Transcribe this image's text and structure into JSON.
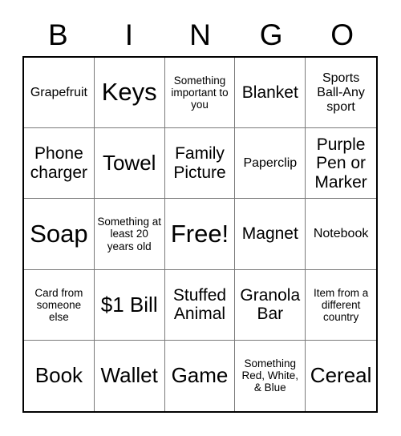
{
  "card": {
    "header_letters": [
      "B",
      "I",
      "N",
      "G",
      "O"
    ],
    "rows": [
      [
        {
          "text": "Grapefruit",
          "size": "t-sm"
        },
        {
          "text": "Keys",
          "size": "t-xl"
        },
        {
          "text": "Something important to you",
          "size": "t-xs"
        },
        {
          "text": "Blanket",
          "size": "t-md"
        },
        {
          "text": "Sports Ball-Any sport",
          "size": "t-sm"
        }
      ],
      [
        {
          "text": "Phone charger",
          "size": "t-md"
        },
        {
          "text": "Towel",
          "size": "t-lg"
        },
        {
          "text": "Family Picture",
          "size": "t-md"
        },
        {
          "text": "Paperclip",
          "size": "t-sm"
        },
        {
          "text": "Purple Pen or Marker",
          "size": "t-md"
        }
      ],
      [
        {
          "text": "Soap",
          "size": "t-xl"
        },
        {
          "text": "Something at least 20 years old",
          "size": "t-xs"
        },
        {
          "text": "Free!",
          "size": "t-xl"
        },
        {
          "text": "Magnet",
          "size": "t-md"
        },
        {
          "text": "Notebook",
          "size": "t-sm"
        }
      ],
      [
        {
          "text": "Card from someone else",
          "size": "t-xs"
        },
        {
          "text": "$1 Bill",
          "size": "t-lg"
        },
        {
          "text": "Stuffed Animal",
          "size": "t-md"
        },
        {
          "text": "Granola Bar",
          "size": "t-md"
        },
        {
          "text": "Item from a different country",
          "size": "t-xs"
        }
      ],
      [
        {
          "text": "Book",
          "size": "t-lg"
        },
        {
          "text": "Wallet",
          "size": "t-lg"
        },
        {
          "text": "Game",
          "size": "t-lg"
        },
        {
          "text": "Something Red, White, & Blue",
          "size": "t-xs"
        },
        {
          "text": "Cereal",
          "size": "t-lg"
        }
      ]
    ],
    "colors": {
      "outer_border": "#000000",
      "inner_border": "#7a7a7a",
      "cell_background": "#ffffff",
      "text": "#000000"
    }
  }
}
